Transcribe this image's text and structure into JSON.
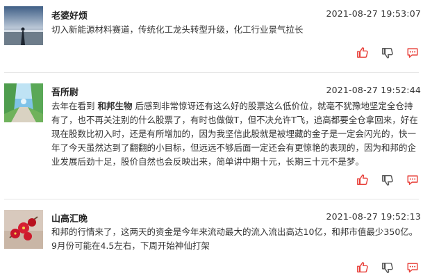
{
  "posts": [
    {
      "username": "老婆好烦",
      "time": "2021-08-27 19:53:07",
      "content": "切入新能源材料赛道，传统化工龙头转型升级，化工行业景气拉长",
      "avatar_icon": "beach-sunset-avatar"
    },
    {
      "username": "吾所尉",
      "time": "2021-08-27 19:52:44",
      "content_pre": "去年在看到 ",
      "content_highlight": "和邦生物",
      "content_post": " 后感到非常惊讶还有这么好的股票这么低价位，就毫不犹豫地坚定全仓持有了，也不再关注别的什么股票了，有时也做做T，但不决允许T飞，追高都要全仓拿回来，好在现在股数比初入时，还是有所增加的，因为我坚信此股就是被埋藏的金子是一定会闪光的，快一年了今天虽然达到了翻翻的小目标，但远远不够后面一定还会有更惊艳的表现的，因为和邦的企业发展后劲十足，股价自然也会反映出来，简单讲中期十元，长期三十元不是梦。",
      "avatar_icon": "park-path-avatar"
    },
    {
      "username": "山高汇晚",
      "time": "2021-08-27 19:52:13",
      "content": "和邦的行情来了，这两天的资金是今年来流动最大的流入流出高达10亿，和邦市值最少350亿。9月份可能在4.5左右，下周开始神仙打架",
      "avatar_icon": "red-flowers-avatar"
    }
  ],
  "colors": {
    "accent": "#e8403a",
    "divider": "#e5e5e5"
  },
  "action_icons": [
    "thumbs-up-icon",
    "thumbs-down-icon",
    "comment-icon"
  ]
}
